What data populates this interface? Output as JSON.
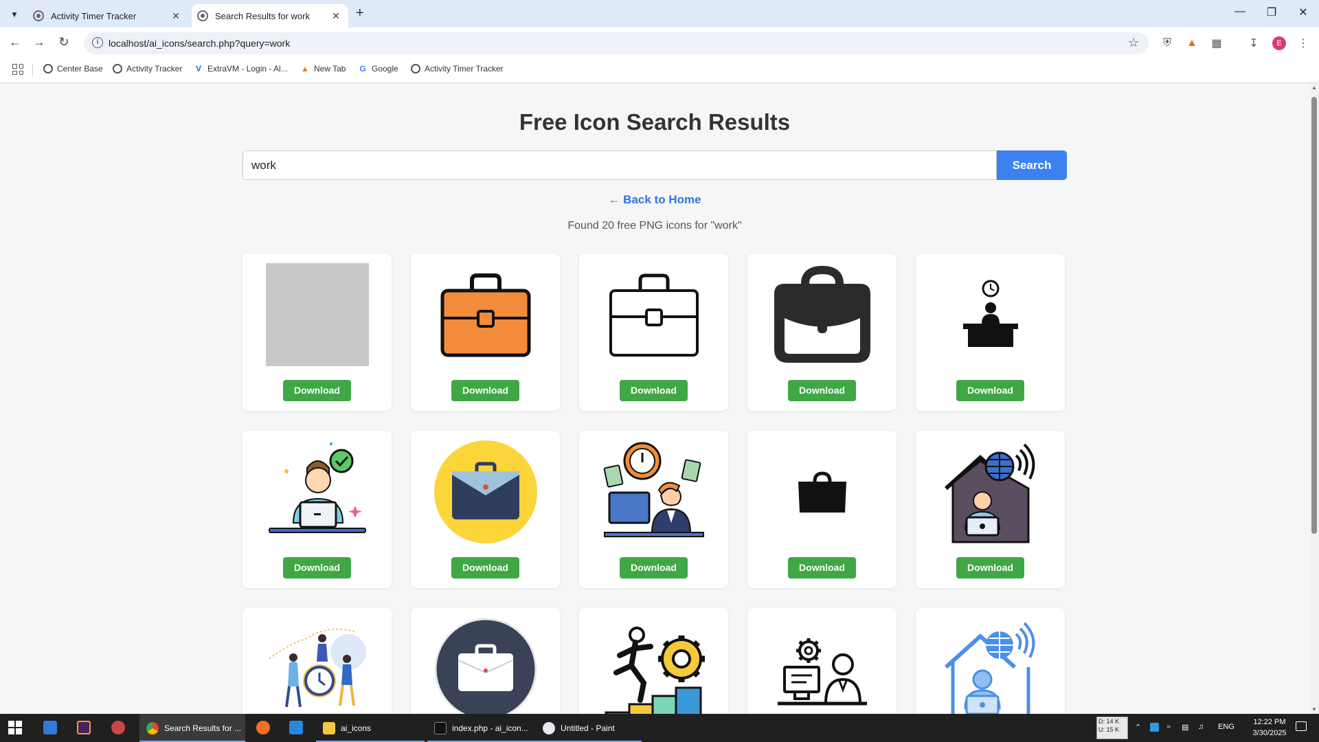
{
  "browser": {
    "tabs": [
      {
        "title": "Activity Timer Tracker",
        "active": false
      },
      {
        "title": "Search Results for work",
        "active": true
      }
    ],
    "url": "localhost/ai_icons/search.php?query=work",
    "profile_initial": "E",
    "bookmarks": [
      "Center Base",
      "Activity Tracker",
      "ExtraVM - Login - Al...",
      "New Tab",
      "Google",
      "Activity Timer Tracker"
    ]
  },
  "page": {
    "title": "Free Icon Search Results",
    "search_value": "work",
    "search_button": "Search",
    "back_link": "← Back to Home",
    "results_text": "Found 20 free PNG icons for \"work\"",
    "download_label": "Download",
    "icons": [
      "placeholder-icon",
      "orange-briefcase-icon",
      "outline-briefcase-icon",
      "black-briefcase-icon",
      "desk-clock-worker-icon",
      "laptop-worker-checkmark-icon",
      "briefcase-yellow-circle-icon",
      "office-worker-clock-icon",
      "small-bag-icon",
      "home-office-globe-icon",
      "team-clock-illustration-icon",
      "briefcase-dark-circle-icon",
      "climbing-gear-icon",
      "computer-gear-person-icon",
      "blue-home-office-icon"
    ]
  },
  "taskbar": {
    "items": [
      "Search Results for ...",
      "ai_icons",
      "index.php - ai_icon...",
      "Untitled - Paint"
    ],
    "network": {
      "down": "D: 14 K",
      "up": "U: 15 K"
    },
    "lang": "ENG",
    "time": "12:22 PM",
    "date": "3/30/2025"
  },
  "colors": {
    "accent": "#3b82f0",
    "download": "#3fa845",
    "link": "#2a74e0"
  }
}
